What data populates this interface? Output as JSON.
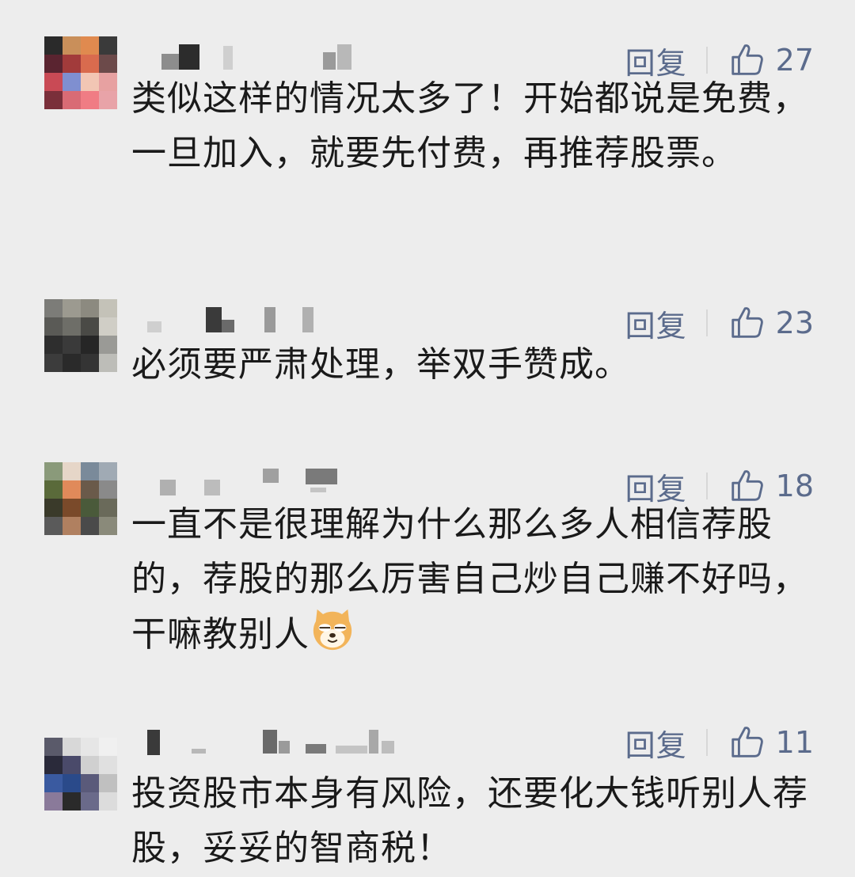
{
  "comments": [
    {
      "reply_label": "回复",
      "like_count": "27",
      "text": "类似这样的情况太多了！开始都说是免费，一旦加入，就要先付费，再推荐股票。"
    },
    {
      "reply_label": "回复",
      "like_count": "23",
      "text": "必须要严肃处理，举双手赞成。"
    },
    {
      "reply_label": "回复",
      "like_count": "18",
      "text": "一直不是很理解为什么那么多人相信荐股的，荐股的那么厉害自己炒自己赚不好吗，干嘛教别人",
      "emoji": "doge-emoji"
    },
    {
      "reply_label": "回复",
      "like_count": "11",
      "text": "投资股市本身有风险，还要化大钱听别人荐股，妥妥的智商税！"
    }
  ],
  "icons": {
    "like": "thumbs-up-icon"
  },
  "colors": {
    "background": "#ededed",
    "action_text": "#5b6b8c",
    "body_text": "#1a1a1a"
  }
}
